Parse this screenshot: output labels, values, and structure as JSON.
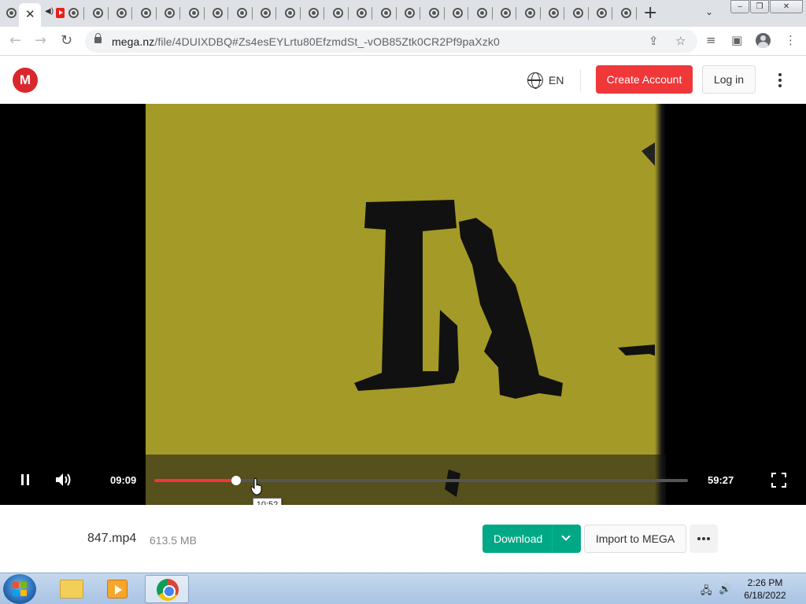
{
  "browser": {
    "active_tab_close": "✕",
    "new_tab": "+",
    "tab_search": "⌄",
    "url_host": "mega.nz",
    "url_path": "/file/4DUIXDBQ#Zs4esEYLrtu80EfzmdSt_-vOB85Ztk0CR2Pf9paXzk0",
    "window_buttons": [
      "–",
      "❐",
      "✕"
    ]
  },
  "header": {
    "logo_text": "M",
    "language": "EN",
    "create_account": "Create Account",
    "log_in": "Log in"
  },
  "player": {
    "current_time": "09:09",
    "duration": "59:27",
    "progress_fraction": 0.154,
    "hover_time": "10:52",
    "accent_color": "#f0373a"
  },
  "file": {
    "name": "847.mp4",
    "size": "613.5 MB",
    "download_label": "Download",
    "import_label": "Import to MEGA"
  },
  "taskbar": {
    "time": "2:26 PM",
    "date": "6/18/2022"
  },
  "icons": {
    "brand_color": "#d9272e",
    "download_color": "#00a886"
  }
}
